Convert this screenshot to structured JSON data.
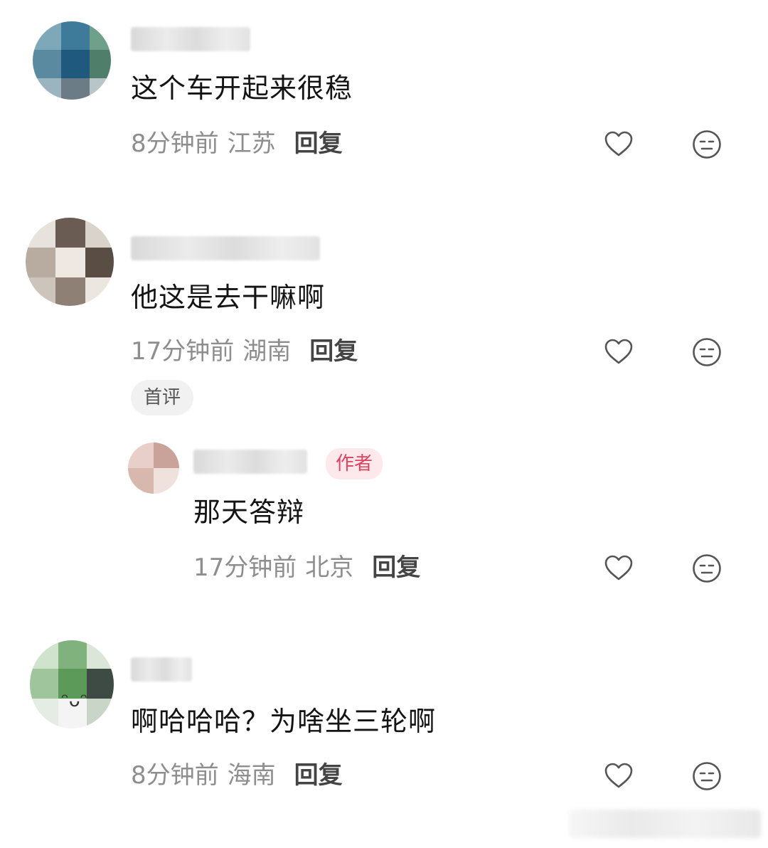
{
  "comments": [
    {
      "text": "这个车开起来很稳",
      "time": "8分钟前",
      "location": "江苏",
      "reply_label": "回复",
      "like_icon": "heart-icon",
      "dislike_icon": "neutral-face-icon"
    },
    {
      "text": "他这是去干嘛啊",
      "time": "17分钟前",
      "location": "湖南",
      "reply_label": "回复",
      "badge": "首评",
      "like_icon": "heart-icon",
      "dislike_icon": "neutral-face-icon",
      "reply": {
        "author_badge": "作者",
        "text": "那天答辩",
        "time": "17分钟前",
        "location": "北京",
        "reply_label": "回复",
        "like_icon": "heart-icon",
        "dislike_icon": "neutral-face-icon"
      }
    },
    {
      "text": "啊哈哈哈？为啥坐三轮啊",
      "time": "8分钟前",
      "location": "海南",
      "reply_label": "回复",
      "like_icon": "heart-icon",
      "dislike_icon": "neutral-face-icon"
    }
  ],
  "colors": {
    "author_badge_bg": "#fde8ec",
    "author_badge_text": "#e4405f",
    "meta_text": "#8e8e8e"
  }
}
